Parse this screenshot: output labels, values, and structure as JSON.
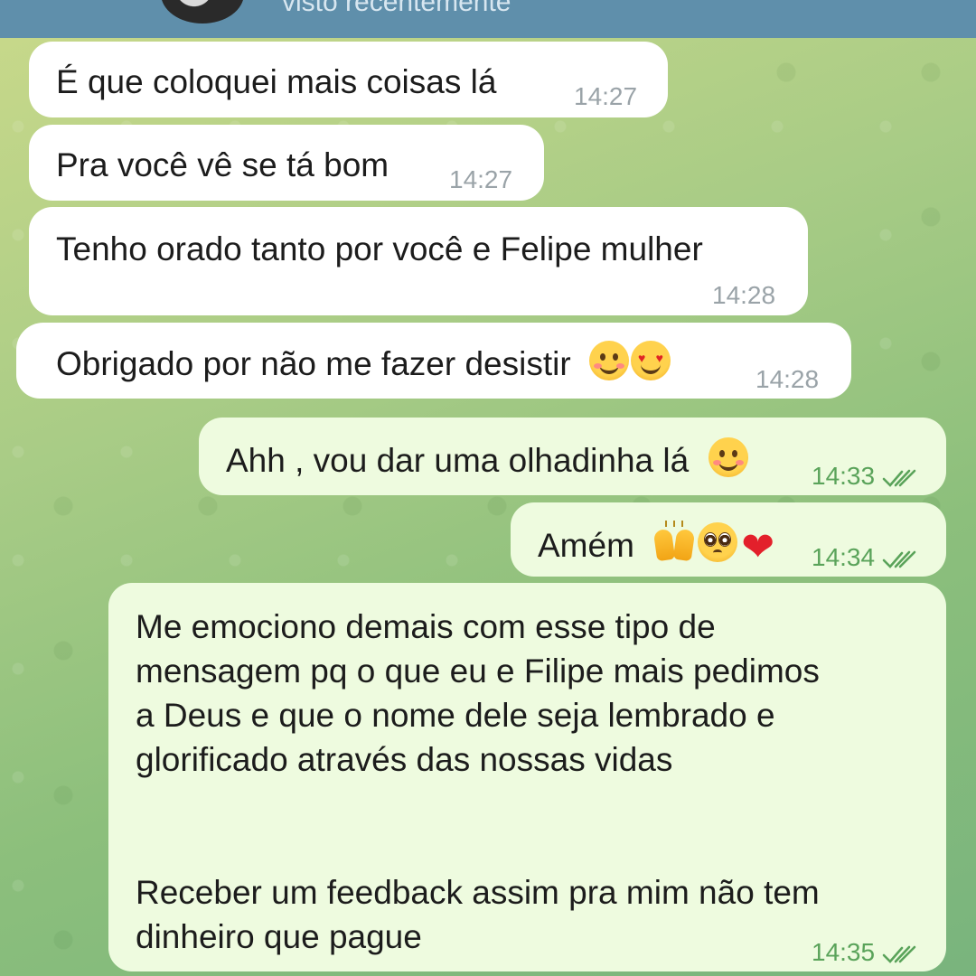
{
  "header": {
    "status": "visto recentemente"
  },
  "messages": [
    {
      "direction": "in",
      "text": "É que coloquei mais coisas lá",
      "time": "14:27"
    },
    {
      "direction": "in",
      "text": "Pra você vê se tá bom",
      "time": "14:27"
    },
    {
      "direction": "in",
      "text": "Tenho orado tanto por você e Felipe mulher",
      "time": "14:28"
    },
    {
      "direction": "in",
      "text": "Obrigado por não me fazer desistir",
      "emojis": [
        "smiling-face-with-hearts",
        "heart-eyes"
      ],
      "time": "14:28"
    },
    {
      "direction": "out",
      "text": "Ahh , vou dar uma olhadinha lá",
      "emojis": [
        "smiling-face"
      ],
      "time": "14:33",
      "read": true
    },
    {
      "direction": "out",
      "text": "Amém",
      "emojis": [
        "raising-hands",
        "pleading-face",
        "red-heart"
      ],
      "time": "14:34",
      "read": true
    },
    {
      "direction": "out",
      "text": "Me emociono demais com esse tipo de\nmensagem pq o que eu e Filipe mais pedimos\na Deus e que o nome dele seja lembrado e\nglorificado através das nossas vidas\n\n\nReceber um feedback assim pra mim não tem\ndinheiro que pague",
      "time": "14:35",
      "read": true
    }
  ],
  "colors": {
    "header": "#5f8fab",
    "incoming_bubble": "#ffffff",
    "outgoing_bubble": "#eefbdf",
    "outgoing_time": "#5aa35a",
    "incoming_time": "#9aa3a8"
  }
}
